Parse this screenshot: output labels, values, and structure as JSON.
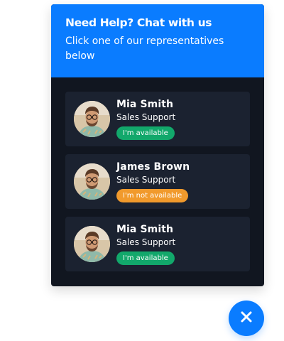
{
  "header": {
    "title": "Need Help? Chat with us",
    "subtitle": "Click one of our representatives below"
  },
  "representatives": [
    {
      "name": "Mia Smith",
      "role": "Sales Support",
      "status": "I'm available",
      "status_color": "#12a86b"
    },
    {
      "name": "James Brown",
      "role": "Sales Support",
      "status": "I'm not available",
      "status_color": "#f19a2c"
    },
    {
      "name": "Mia Smith",
      "role": "Sales Support",
      "status": "I'm available",
      "status_color": "#12a86b"
    }
  ],
  "close_button": {
    "icon": "close-icon"
  },
  "colors": {
    "primary": "#0a7cff",
    "panel_bg": "#111620",
    "card_bg": "#1b2230",
    "available": "#12a86b",
    "unavailable": "#f19a2c"
  }
}
